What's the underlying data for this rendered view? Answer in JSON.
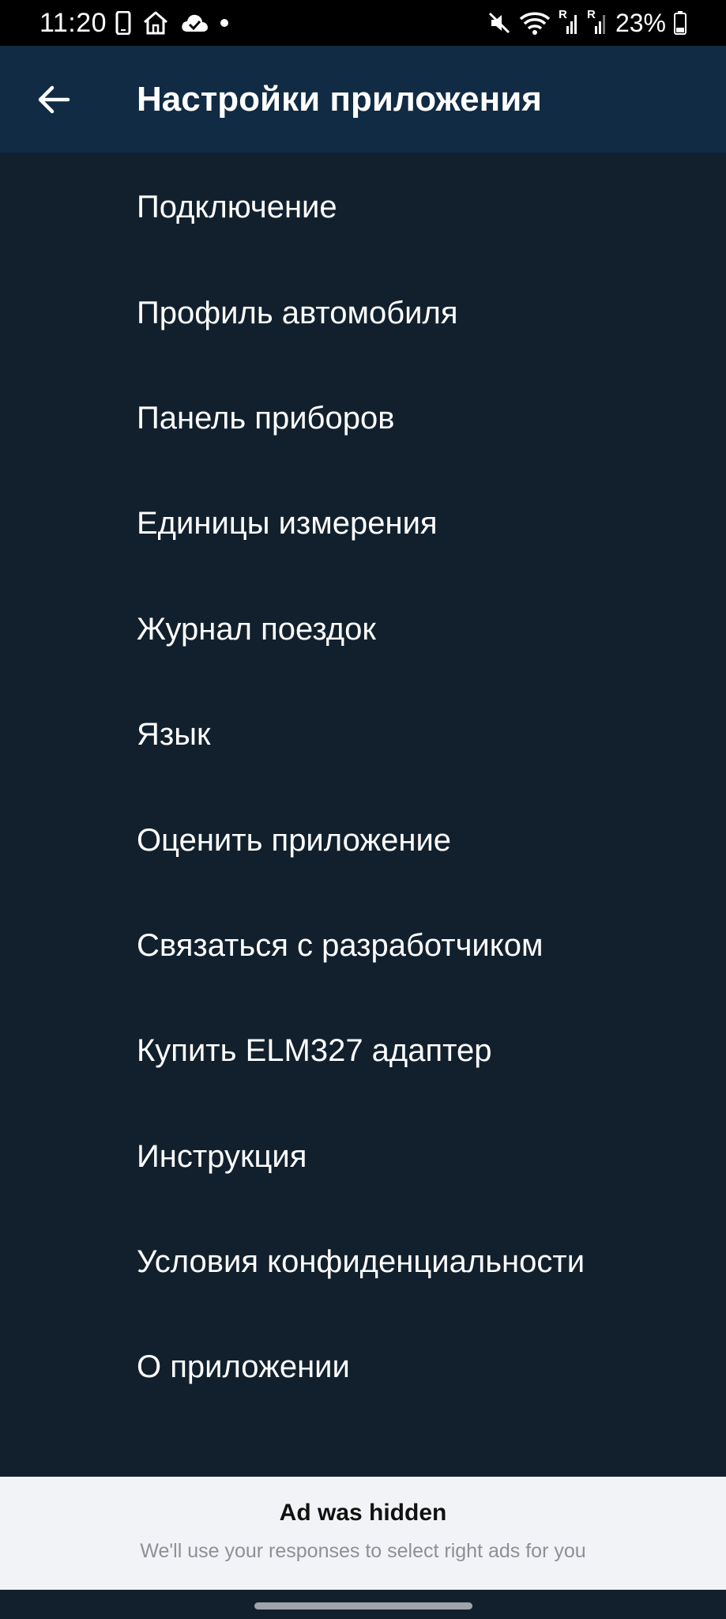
{
  "status_bar": {
    "time": "11:20",
    "battery_text": "23%",
    "left_icons": [
      "phone-icon",
      "home-icon",
      "cloud-check-icon",
      "dot-icon"
    ],
    "right_icons": [
      "mute-icon",
      "wifi-icon",
      "signal-r-icon",
      "signal-r-icon",
      "battery-icon"
    ],
    "signal_badge": "R"
  },
  "app_bar": {
    "title": "Настройки приложения",
    "back_icon": "arrow-left-icon"
  },
  "menu": {
    "items": [
      {
        "label": "Подключение"
      },
      {
        "label": "Профиль автомобиля"
      },
      {
        "label": "Панель приборов"
      },
      {
        "label": "Единицы измерения"
      },
      {
        "label": "Журнал поездок"
      },
      {
        "label": "Язык"
      },
      {
        "label": "Оценить приложение"
      },
      {
        "label": "Связаться с разработчиком"
      },
      {
        "label": "Купить ELM327 адаптер"
      },
      {
        "label": "Инструкция"
      },
      {
        "label": "Условия конфиденциальности"
      },
      {
        "label": "О приложении"
      }
    ]
  },
  "ad": {
    "title": "Ad was hidden",
    "subtitle": "We'll use your responses to select right ads for you"
  },
  "colors": {
    "background": "#12202e",
    "app_bar": "#102b43",
    "text": "#ffffff",
    "ad_background": "#f2f3f6",
    "ad_subtitle": "#8e9098"
  }
}
